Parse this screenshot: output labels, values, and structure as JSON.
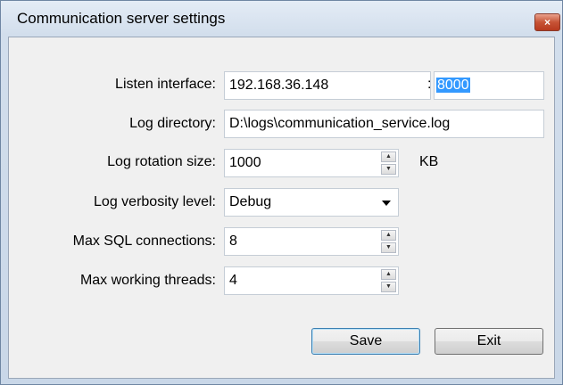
{
  "window": {
    "title": "Communication server settings",
    "close_glyph": "×"
  },
  "form": {
    "listen_interface": {
      "label": "Listen interface:",
      "ip": "192.168.36.148",
      "separator": ":",
      "port": "8000"
    },
    "log_directory": {
      "label": "Log directory:",
      "value": "D:\\logs\\communication_service.log"
    },
    "log_rotation_size": {
      "label": "Log rotation size:",
      "value": "1000",
      "unit": "KB"
    },
    "log_verbosity": {
      "label": "Log verbosity level:",
      "value": "Debug"
    },
    "max_sql_connections": {
      "label": "Max SQL connections:",
      "value": "8"
    },
    "max_working_threads": {
      "label": "Max working threads:",
      "value": "4"
    }
  },
  "buttons": {
    "save": "Save",
    "exit": "Exit"
  },
  "spin": {
    "up": "▲",
    "down": "▼"
  }
}
